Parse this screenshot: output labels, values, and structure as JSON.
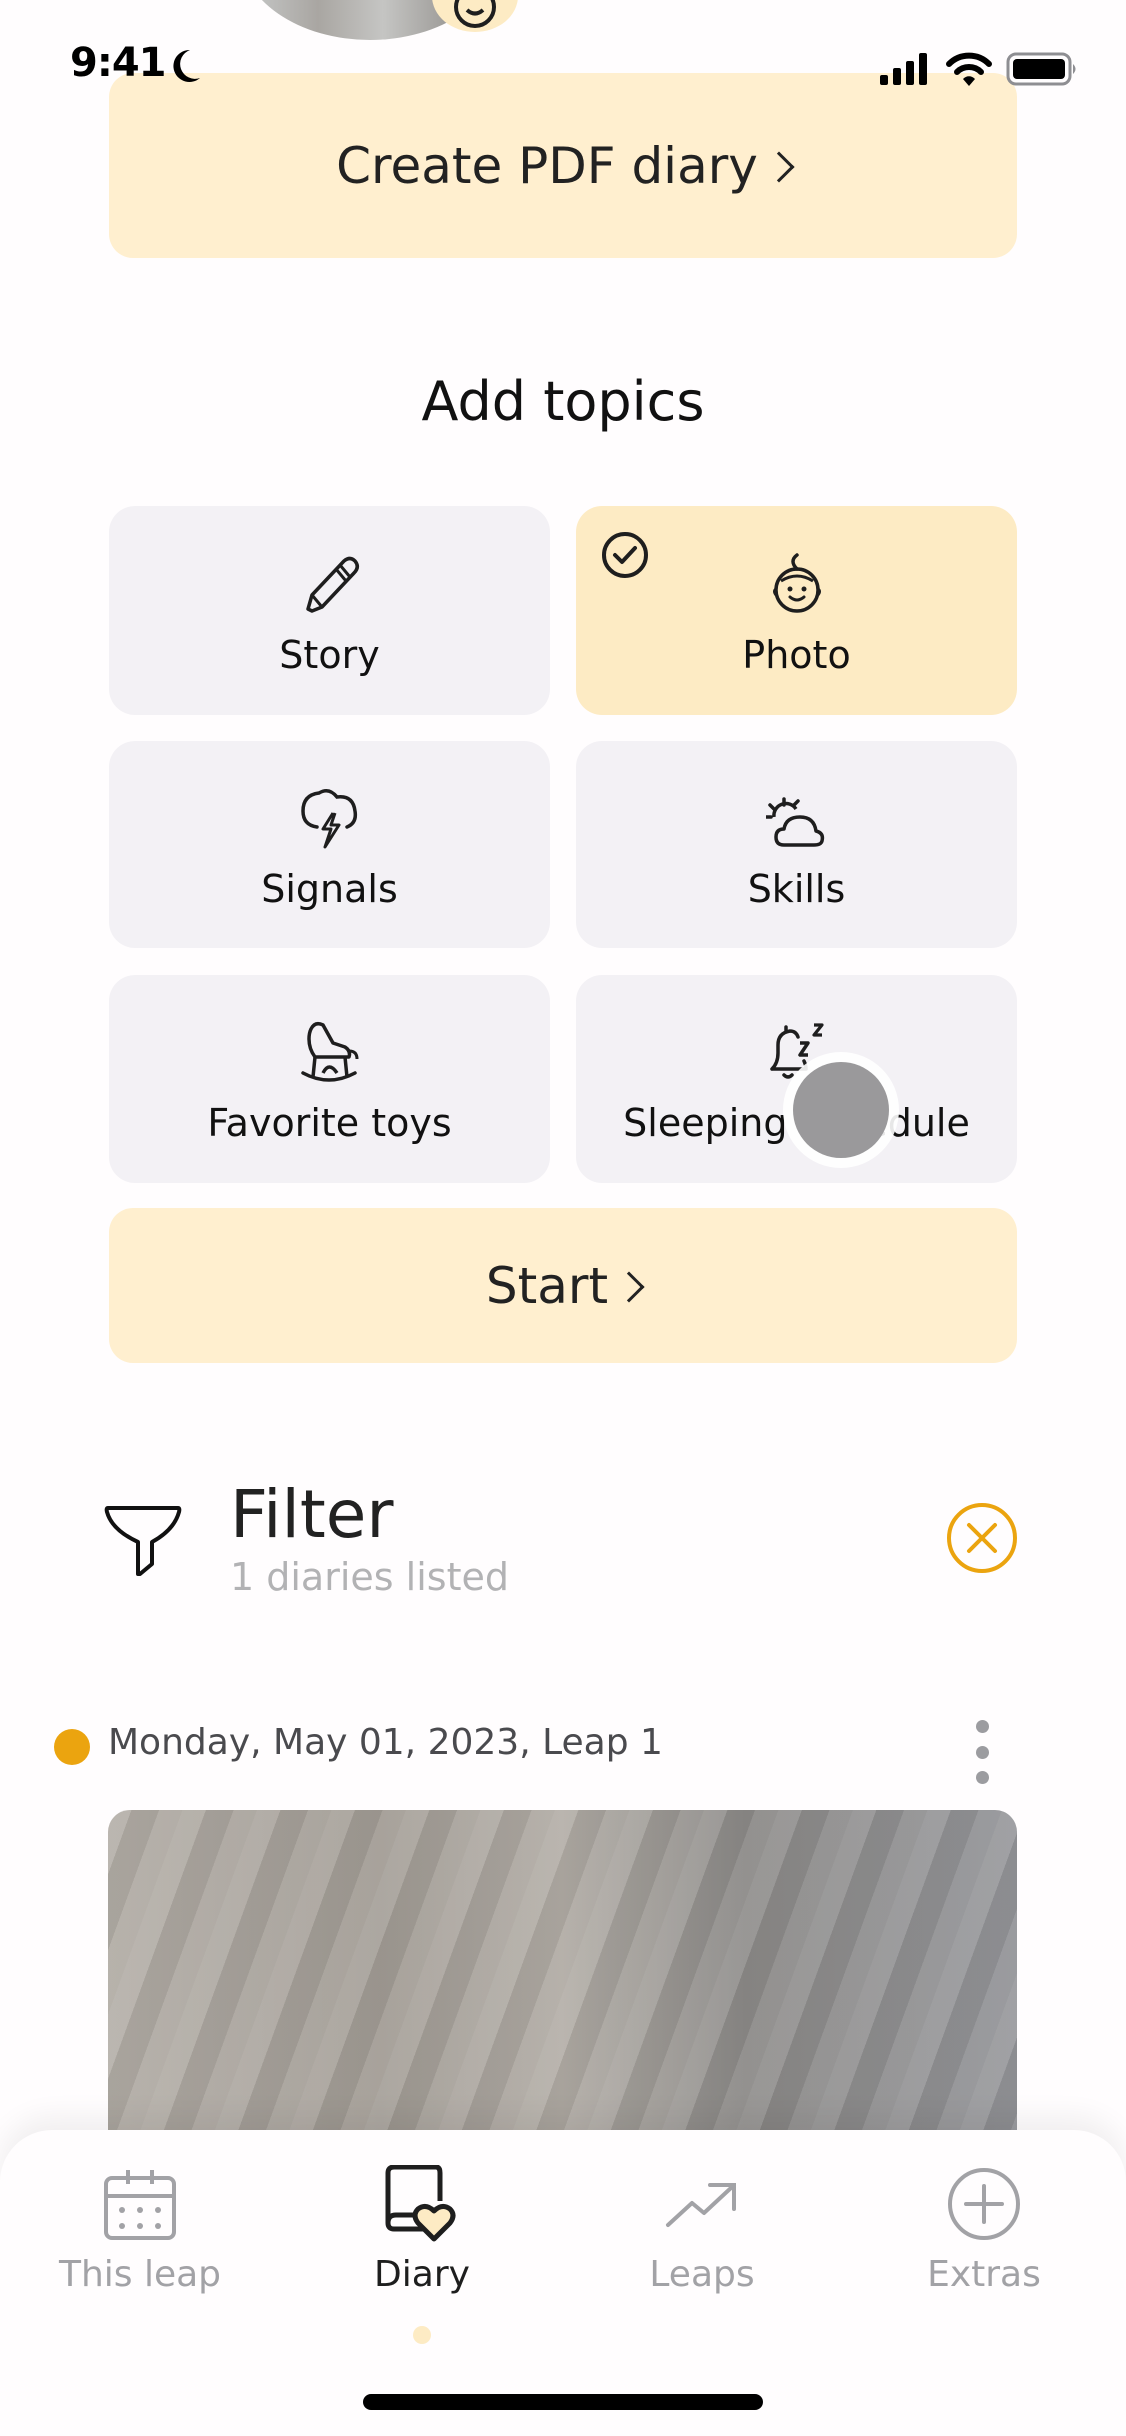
{
  "status_bar": {
    "time": "9:41",
    "focus_icon": "moon-icon",
    "icons": [
      "cellular-signal-icon",
      "wifi-icon",
      "battery-icon"
    ]
  },
  "profile": {
    "avatar": "baby-photo",
    "badge_icon": "baby-face-icon"
  },
  "pdf_button": {
    "label": "Create PDF diary",
    "icon": "chevron-right-icon"
  },
  "add_topics": {
    "title": "Add topics",
    "topics": [
      {
        "label": "Story",
        "icon": "pencil-icon",
        "selected": false
      },
      {
        "label": "Photo",
        "icon": "baby-face-icon",
        "selected": true
      },
      {
        "label": "Signals",
        "icon": "storm-cloud-icon",
        "selected": false
      },
      {
        "label": "Skills",
        "icon": "sun-cloud-icon",
        "selected": false
      },
      {
        "label": "Favorite toys",
        "icon": "rocking-horse-icon",
        "selected": false
      },
      {
        "label": "Sleeping schedule",
        "icon": "bell-sleep-icon",
        "selected": false
      }
    ],
    "start_label": "Start"
  },
  "filter": {
    "title": "Filter",
    "subtitle": "1 diaries listed",
    "icon": "funnel-icon",
    "clear_icon": "close-circle-icon"
  },
  "entries": [
    {
      "date": "Monday, May 01, 2023, Leap 1",
      "dot_color": "#EBA40F",
      "media": "photo"
    }
  ],
  "tabbar": {
    "tabs": [
      {
        "label": "This leap",
        "icon": "calendar-icon",
        "active": false
      },
      {
        "label": "Diary",
        "icon": "diary-heart-icon",
        "active": true
      },
      {
        "label": "Leaps",
        "icon": "trending-up-icon",
        "active": false
      },
      {
        "label": "Extras",
        "icon": "plus-circle-icon",
        "active": false
      }
    ]
  },
  "colors": {
    "accent": "#EBA40F",
    "button_bg": "#FFEFCF",
    "selected_card": "#FDEBC4",
    "card_bg": "#F3F1F5",
    "inactive_tab": "#A2A2A6"
  }
}
